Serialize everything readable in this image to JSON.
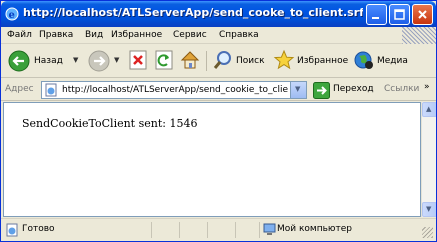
{
  "window": {
    "title": "http://localhost/ATLServerApp/send_cooke_to_client.srf - Mic..."
  },
  "menu": {
    "items": [
      "Файл",
      "Правка",
      "Вид",
      "Избранное",
      "Сервис",
      "Справка"
    ]
  },
  "toolbar": {
    "back_label": "Назад",
    "search_label": "Поиск",
    "favorites_label": "Избранное",
    "media_label": "Медиа"
  },
  "address": {
    "label": "Адрес",
    "value": "http://localhost/ATLServerApp/send_cookie_to_client.s",
    "go_label": "Переход",
    "links_label": "Ссылки"
  },
  "page": {
    "body_text": "SendCookieToClient sent: 1546"
  },
  "status": {
    "text": "Готово",
    "zone": "Мой компьютер"
  },
  "colors": {
    "titlebar": "#0054e3",
    "chrome": "#ece9d8",
    "accent_border": "#7f9db9"
  }
}
